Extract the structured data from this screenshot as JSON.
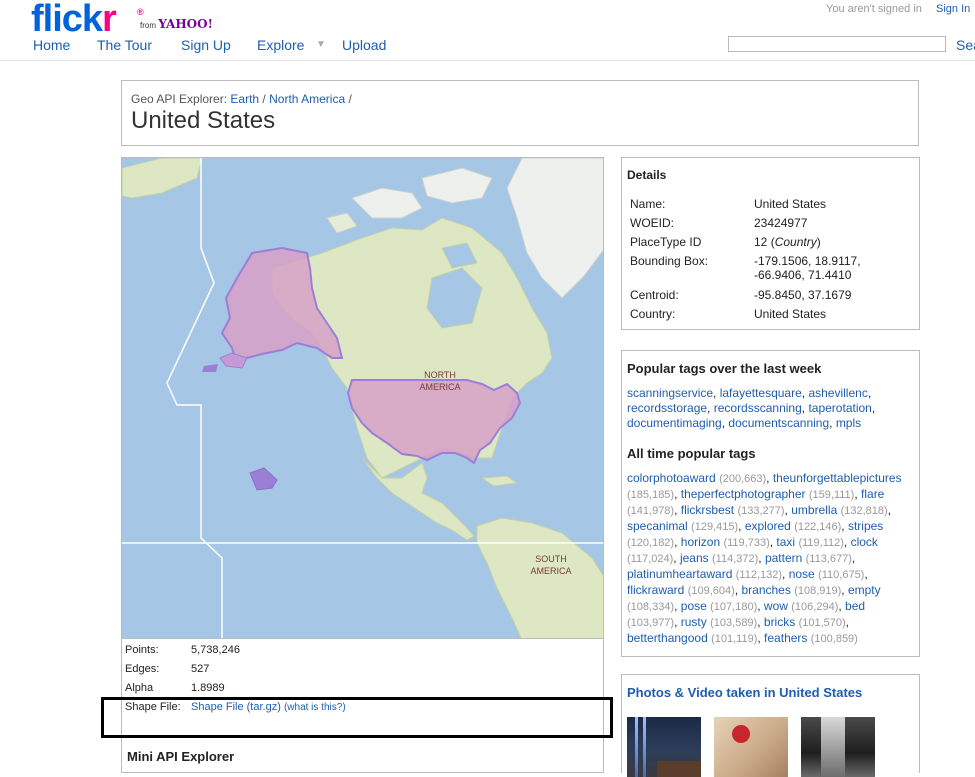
{
  "header": {
    "logo_flick": "flick",
    "logo_r": "r",
    "logo_reg": "®",
    "from_text": "from",
    "yahoo_text": "YAHOO!",
    "not_signed_in": "You aren't signed in",
    "sign_in": "Sign In",
    "search_label": "Sea",
    "search_value": ""
  },
  "nav": {
    "home": "Home",
    "tour": "The Tour",
    "signup": "Sign Up",
    "explore": "Explore",
    "explore_caret": "▼",
    "upload": "Upload"
  },
  "title": {
    "crumb_prefix": "Geo API Explorer:",
    "crumb_earth": "Earth",
    "crumb_sep1": "/",
    "crumb_na": "North America",
    "crumb_sep2": "/",
    "heading": "United States"
  },
  "map": {
    "label_na_1": "NORTH",
    "label_na_2": "AMERICA",
    "label_sa_1": "SOUTH",
    "label_sa_2": "AMERICA"
  },
  "stats": {
    "points_label": "Points:",
    "points_value": "5,738,246",
    "edges_label": "Edges:",
    "edges_value": "527",
    "alpha_label": "Alpha",
    "alpha_value": "1.8989",
    "shape_label": "Shape File:",
    "shape_link": "Shape File (tar.gz)",
    "shape_help_open": "(",
    "shape_help": "what is this?",
    "shape_help_close": ")"
  },
  "mini_api": "Mini API Explorer",
  "details": {
    "title": "Details",
    "name_label": "Name:",
    "name_value": "United States",
    "woeid_label": "WOEID:",
    "woeid_value": "23424977",
    "placetype_label": "PlaceType ID",
    "placetype_value": "12",
    "placetype_italic": "Country",
    "bbox_label": "Bounding Box:",
    "bbox_line1": "-179.1506, 18.9117,",
    "bbox_line2": "-66.9406, 71.4410",
    "centroid_label": "Centroid:",
    "centroid_value": "-95.8450, 37.1679",
    "country_label": "Country:",
    "country_value": "United States"
  },
  "popular_week": {
    "title": "Popular tags over the last week",
    "tags": [
      "scanningservice",
      "lafayettesquare",
      "ashevillenc",
      "recordsstorage",
      "recordsscanning",
      "taperotation",
      "documentimaging",
      "documentscanning",
      "mpls"
    ]
  },
  "all_time": {
    "title": "All time popular tags",
    "tags": [
      {
        "tag": "colorphotoaward",
        "count": "(200,663)"
      },
      {
        "tag": "theunforgettablepictures",
        "count": "(185,185)"
      },
      {
        "tag": "theperfectphotographer",
        "count": "(159,111)"
      },
      {
        "tag": "flare",
        "count": "(141,978)"
      },
      {
        "tag": "flickrsbest",
        "count": "(133,277)"
      },
      {
        "tag": "umbrella",
        "count": "(132,818)"
      },
      {
        "tag": "specanimal",
        "count": "(129,415)"
      },
      {
        "tag": "explored",
        "count": "(122,146)"
      },
      {
        "tag": "stripes",
        "count": "(120,182)"
      },
      {
        "tag": "horizon",
        "count": "(119,733)"
      },
      {
        "tag": "taxi",
        "count": "(119,112)"
      },
      {
        "tag": "clock",
        "count": "(117,024)"
      },
      {
        "tag": "jeans",
        "count": "(114,372)"
      },
      {
        "tag": "pattern",
        "count": "(113,677)"
      },
      {
        "tag": "platinumheartaward",
        "count": "(112,132)"
      },
      {
        "tag": "nose",
        "count": "(110,675)"
      },
      {
        "tag": "flickraward",
        "count": "(109,604)"
      },
      {
        "tag": "branches",
        "count": "(108,919)"
      },
      {
        "tag": "empty",
        "count": "(108,334)"
      },
      {
        "tag": "pose",
        "count": "(107,180)"
      },
      {
        "tag": "wow",
        "count": "(106,294)"
      },
      {
        "tag": "bed",
        "count": "(103,977)"
      },
      {
        "tag": "rusty",
        "count": "(103,589)"
      },
      {
        "tag": "bricks",
        "count": "(101,570)"
      },
      {
        "tag": "betterthangood",
        "count": "(101,119)"
      },
      {
        "tag": "feathers",
        "count": "(100,859)"
      }
    ]
  },
  "photos": {
    "title": "Photos & Video taken in United States"
  },
  "colors": {
    "link": "#1e5db1",
    "flickr_blue": "#0063dc",
    "flickr_pink": "#ff0084",
    "ocean": "#a6c6e6",
    "land": "#dde7c4",
    "shape_fill": "#d7a0c8",
    "shape_edge": "#9b7fd6"
  }
}
